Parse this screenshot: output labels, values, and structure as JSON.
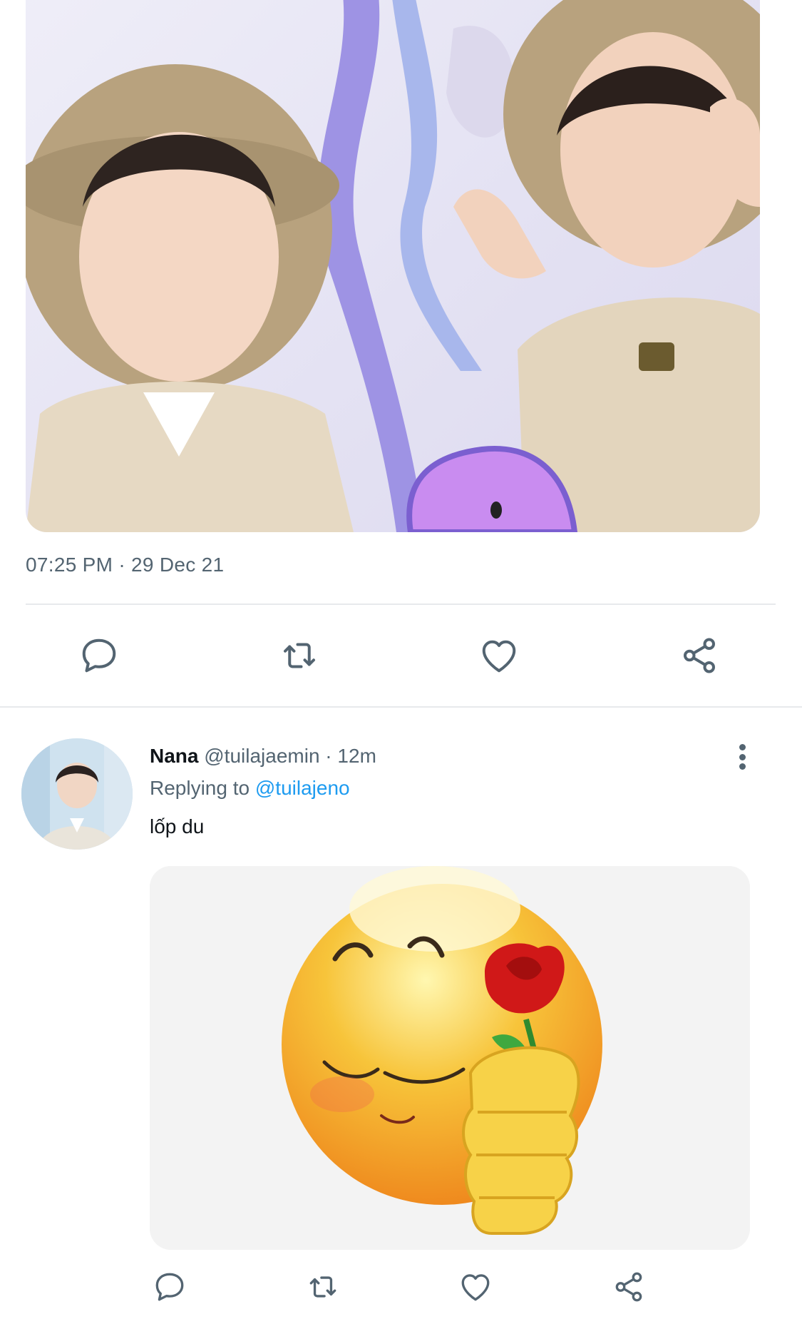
{
  "tweet": {
    "media_alt": "",
    "timestamp": "07:25 PM · 29 Dec 21",
    "actions": [
      {
        "name": "reply",
        "icon": "reply-icon"
      },
      {
        "name": "retweet",
        "icon": "retweet-icon"
      },
      {
        "name": "like",
        "icon": "heart-icon"
      },
      {
        "name": "share",
        "icon": "share-icon"
      }
    ]
  },
  "reply": {
    "display_name": "Nana",
    "handle": "@tuilajaemin",
    "separator": " · ",
    "time": "12m",
    "replying_prefix": "Replying to ",
    "replying_to": "@tuilajeno",
    "text": "lốp du",
    "more_icon": "more-vertical-icon",
    "actions": [
      {
        "name": "reply",
        "icon": "reply-icon"
      },
      {
        "name": "retweet",
        "icon": "retweet-icon"
      },
      {
        "name": "like",
        "icon": "heart-icon"
      },
      {
        "name": "share",
        "icon": "share-icon"
      }
    ]
  },
  "colors": {
    "icon_gray": "#536471",
    "link_blue": "#1d9bf0",
    "divider": "#e7e9ec"
  }
}
